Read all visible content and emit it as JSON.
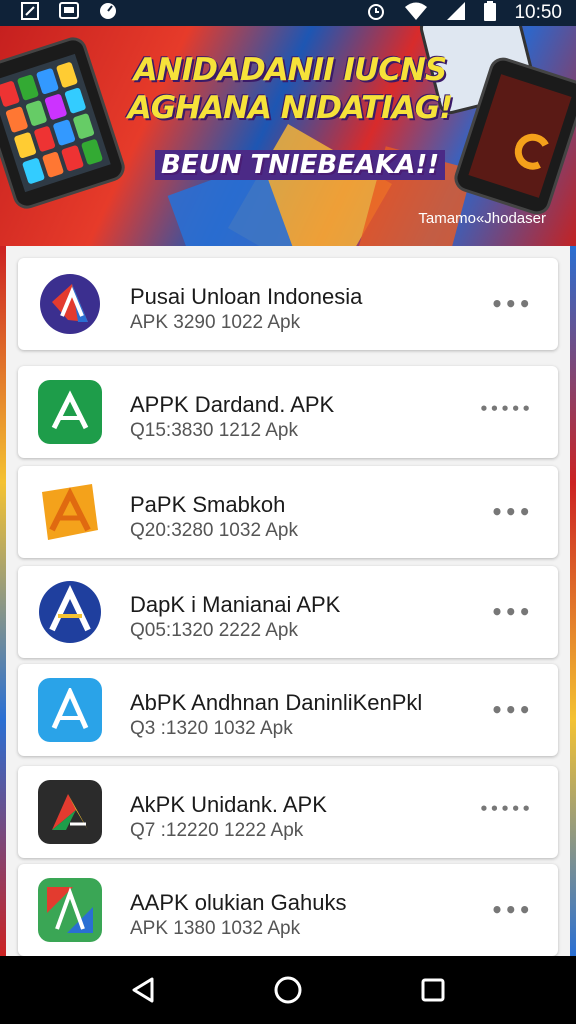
{
  "status_bar": {
    "time": "10:50",
    "icons_left": [
      "screenshot-icon",
      "tablet-icon",
      "speed-icon"
    ],
    "icons_right": [
      "alarm-icon",
      "wifi-icon",
      "signal-icon",
      "battery-icon"
    ]
  },
  "banner": {
    "headline_line1": "ANIDADANII IUCNS",
    "headline_line2": "AGHANA NIDATIAG!",
    "headline_line3": "BEUN TNIEBEAKA!!",
    "caption": "Tamamo«Jhodaser",
    "colors": {
      "headline": "#f6e23a",
      "shadow": "#3a1a68"
    }
  },
  "apps": [
    {
      "name": "Pusai Unloan Indonesia",
      "meta": "APK 3290 1022  Apk",
      "icon": "red-blue-a-icon",
      "more": "•••"
    },
    {
      "name": "APPK Dardand. APK",
      "meta": "Q15:3830 1212  Apk",
      "icon": "green-a-icon",
      "more": "•••••"
    },
    {
      "name": "PaPK Smabkoh",
      "meta": "Q20:3280 1032  Apk",
      "icon": "orange-a-icon",
      "more": "•••"
    },
    {
      "name": "DapK i Manianai APK",
      "meta": "Q05:1320 2222  Apk",
      "icon": "blue-circle-a-icon",
      "more": "•••"
    },
    {
      "name": "AbPK Andhnan  DaninliKenPkl",
      "meta": "Q3 :1320 1032  Apk",
      "icon": "lightblue-a-icon",
      "more": "•••"
    },
    {
      "name": "AkPK Unidank. APK",
      "meta": "Q7 :12220 1222  Apk",
      "icon": "dark-a-icon",
      "more": "•••••"
    },
    {
      "name": "AAPK olukian Gahuks",
      "meta": "APK 1380 1032  Apk",
      "icon": "map-a-icon",
      "more": "•••"
    }
  ],
  "nav": {
    "back": "back-icon",
    "home": "home-icon",
    "recents": "recents-icon"
  }
}
